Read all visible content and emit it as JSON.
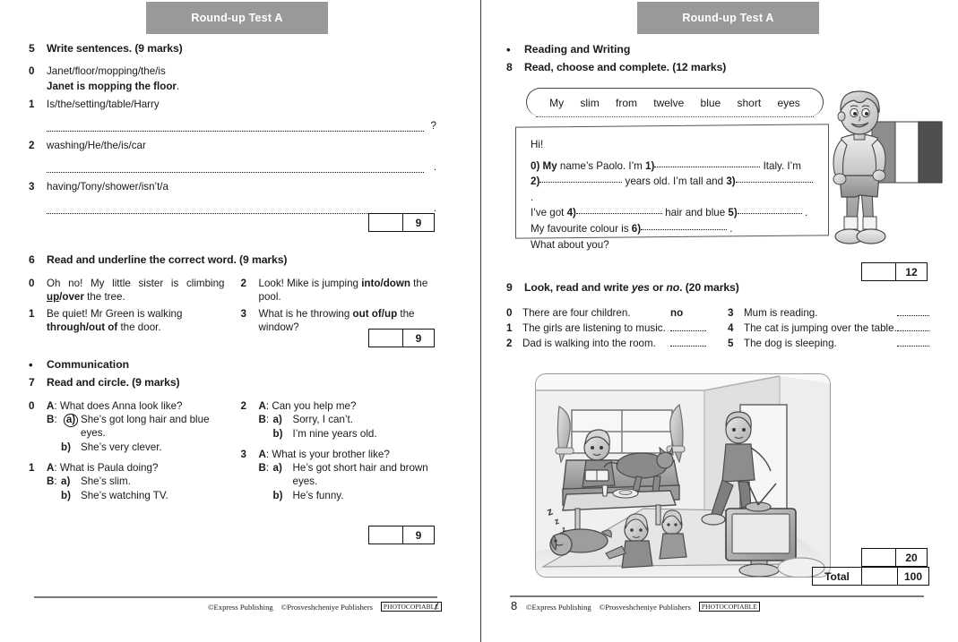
{
  "banner": {
    "title": "Round-up Test A"
  },
  "left_page": {
    "ex5": {
      "number": "5",
      "title": "Write sentences. (9 marks)",
      "items": [
        {
          "n": "0",
          "prompt": "Janet/floor/mopping/the/is",
          "answer": "Janet is mopping the floor",
          "answer_end": "."
        },
        {
          "n": "1",
          "prompt": "Is/the/setting/table/Harry",
          "tail": "?"
        },
        {
          "n": "2",
          "prompt": "washing/He/the/is/car",
          "tail": "."
        },
        {
          "n": "3",
          "prompt": "having/Tony/shower/isn’t/a",
          "tail": "."
        }
      ],
      "score": "9"
    },
    "ex6": {
      "number": "6",
      "title": "Read and underline the correct word. (9 marks)",
      "items": [
        {
          "n": "0",
          "pre": "Oh no! My little sister is climbing ",
          "opt_a": "up",
          "opt_b": "over",
          "post": " the tree.",
          "underline": "a"
        },
        {
          "n": "1",
          "pre": "Be quiet! Mr Green is walking ",
          "opt_a": "through",
          "opt_b": "out of",
          "post": " the door.",
          "underline": "none"
        },
        {
          "n": "2",
          "pre": "Look! Mike is jumping ",
          "opt_a": "into",
          "opt_b": "down",
          "post": " the pool.",
          "underline": "none"
        },
        {
          "n": "3",
          "pre": "What is he throwing ",
          "opt_a": "out of",
          "opt_b": "up",
          "post": " the window?",
          "underline": "none"
        }
      ],
      "score": "9"
    },
    "communication_heading": "Communication",
    "ex7": {
      "number": "7",
      "title": "Read and circle. (9 marks)",
      "items": [
        {
          "n": "0",
          "q": "What does Anna look like?",
          "a": "She’s got long hair and blue eyes.",
          "b": "She’s very clever.",
          "circled": "a"
        },
        {
          "n": "1",
          "q": "What is Paula doing?",
          "a": "She’s slim.",
          "b": "She’s watching TV.",
          "circled": "none"
        },
        {
          "n": "2",
          "q": "Can you help me?",
          "a": "Sorry, I can’t.",
          "b": "I’m nine years old.",
          "circled": "none"
        },
        {
          "n": "3",
          "q": "What is your brother like?",
          "a": "He’s got short hair and brown eyes.",
          "b": "He’s funny.",
          "circled": "none"
        }
      ],
      "score": "9",
      "speaker_a": "A",
      "speaker_b": "B"
    },
    "footer": {
      "publisher1": "©Express Publishing",
      "publisher2": "©Prosveshcheniye Publishers",
      "photocopiable": "PHOTOCOPIABLE",
      "page_number": "7"
    }
  },
  "right_page": {
    "reading_heading": "Reading and Writing",
    "ex8": {
      "number": "8",
      "title": "Read, choose and complete. (12 marks)",
      "word_bank": [
        "My",
        "slim",
        "from",
        "twelve",
        "blue",
        "short",
        "eyes"
      ],
      "letter": {
        "greeting": "Hi!",
        "line1_a": "0)",
        "line1_b": "My",
        "line1_c": " name’s Paolo. I’m ",
        "line1_d": "1)",
        "line1_e": " Italy. I’m",
        "line2_a": "2)",
        "line2_b": " years old. I’m tall and ",
        "line2_c": "3)",
        "line2_d": " .",
        "line3_a": "I’ve got ",
        "line3_b": "4)",
        "line3_c": " hair and blue ",
        "line3_d": "5)",
        "line3_e": " .",
        "line4_a": "My favourite colour is ",
        "line4_b": "6)",
        "line4_c": " .",
        "line5": "What about you?"
      },
      "illustration": "boy-holding-italian-flag",
      "score": "12"
    },
    "ex9": {
      "number": "9",
      "title_a": "Look, read and write ",
      "title_yes": "yes",
      "title_or": " or ",
      "title_no": "no",
      "title_b": ". (20 marks)",
      "items_left": [
        {
          "n": "0",
          "t": "There are four children.",
          "a": "no"
        },
        {
          "n": "1",
          "t": "The girls are listening to music.",
          "a": ""
        },
        {
          "n": "2",
          "t": "Dad is walking into the room.",
          "a": ""
        }
      ],
      "items_right": [
        {
          "n": "3",
          "t": "Mum is reading.",
          "a": ""
        },
        {
          "n": "4",
          "t": "The cat is jumping over the table.",
          "a": ""
        },
        {
          "n": "5",
          "t": "The dog is sleeping.",
          "a": ""
        }
      ],
      "illustration": "living-room-scene-with-family-dog-cat-tv",
      "score": "20"
    },
    "total": {
      "label": "Total",
      "value": "100"
    },
    "footer": {
      "publisher1": "©Express Publishing",
      "publisher2": "©Prosveshcheniye Publishers",
      "photocopiable": "PHOTOCOPIABLE",
      "page_number": "8"
    }
  },
  "colors": {
    "banner_bg": "#999999",
    "banner_text": "#ffffff",
    "ink": "#1a1a1a",
    "rule": "#777777"
  }
}
